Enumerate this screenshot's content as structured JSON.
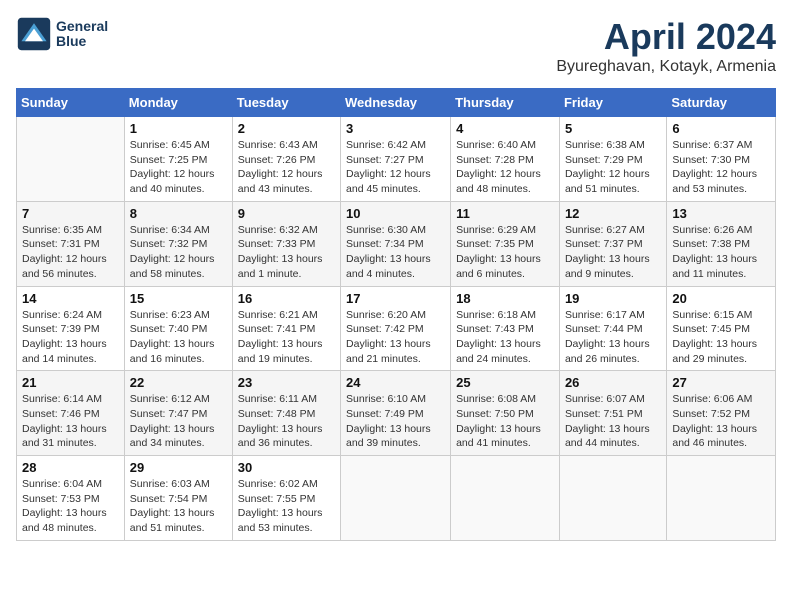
{
  "header": {
    "logo_line1": "General",
    "logo_line2": "Blue",
    "month_title": "April 2024",
    "location": "Byureghavan, Kotayk, Armenia"
  },
  "days_of_week": [
    "Sunday",
    "Monday",
    "Tuesday",
    "Wednesday",
    "Thursday",
    "Friday",
    "Saturday"
  ],
  "weeks": [
    [
      {
        "day": "",
        "sunrise": "",
        "sunset": "",
        "daylight": ""
      },
      {
        "day": "1",
        "sunrise": "Sunrise: 6:45 AM",
        "sunset": "Sunset: 7:25 PM",
        "daylight": "Daylight: 12 hours and 40 minutes."
      },
      {
        "day": "2",
        "sunrise": "Sunrise: 6:43 AM",
        "sunset": "Sunset: 7:26 PM",
        "daylight": "Daylight: 12 hours and 43 minutes."
      },
      {
        "day": "3",
        "sunrise": "Sunrise: 6:42 AM",
        "sunset": "Sunset: 7:27 PM",
        "daylight": "Daylight: 12 hours and 45 minutes."
      },
      {
        "day": "4",
        "sunrise": "Sunrise: 6:40 AM",
        "sunset": "Sunset: 7:28 PM",
        "daylight": "Daylight: 12 hours and 48 minutes."
      },
      {
        "day": "5",
        "sunrise": "Sunrise: 6:38 AM",
        "sunset": "Sunset: 7:29 PM",
        "daylight": "Daylight: 12 hours and 51 minutes."
      },
      {
        "day": "6",
        "sunrise": "Sunrise: 6:37 AM",
        "sunset": "Sunset: 7:30 PM",
        "daylight": "Daylight: 12 hours and 53 minutes."
      }
    ],
    [
      {
        "day": "7",
        "sunrise": "Sunrise: 6:35 AM",
        "sunset": "Sunset: 7:31 PM",
        "daylight": "Daylight: 12 hours and 56 minutes."
      },
      {
        "day": "8",
        "sunrise": "Sunrise: 6:34 AM",
        "sunset": "Sunset: 7:32 PM",
        "daylight": "Daylight: 12 hours and 58 minutes."
      },
      {
        "day": "9",
        "sunrise": "Sunrise: 6:32 AM",
        "sunset": "Sunset: 7:33 PM",
        "daylight": "Daylight: 13 hours and 1 minute."
      },
      {
        "day": "10",
        "sunrise": "Sunrise: 6:30 AM",
        "sunset": "Sunset: 7:34 PM",
        "daylight": "Daylight: 13 hours and 4 minutes."
      },
      {
        "day": "11",
        "sunrise": "Sunrise: 6:29 AM",
        "sunset": "Sunset: 7:35 PM",
        "daylight": "Daylight: 13 hours and 6 minutes."
      },
      {
        "day": "12",
        "sunrise": "Sunrise: 6:27 AM",
        "sunset": "Sunset: 7:37 PM",
        "daylight": "Daylight: 13 hours and 9 minutes."
      },
      {
        "day": "13",
        "sunrise": "Sunrise: 6:26 AM",
        "sunset": "Sunset: 7:38 PM",
        "daylight": "Daylight: 13 hours and 11 minutes."
      }
    ],
    [
      {
        "day": "14",
        "sunrise": "Sunrise: 6:24 AM",
        "sunset": "Sunset: 7:39 PM",
        "daylight": "Daylight: 13 hours and 14 minutes."
      },
      {
        "day": "15",
        "sunrise": "Sunrise: 6:23 AM",
        "sunset": "Sunset: 7:40 PM",
        "daylight": "Daylight: 13 hours and 16 minutes."
      },
      {
        "day": "16",
        "sunrise": "Sunrise: 6:21 AM",
        "sunset": "Sunset: 7:41 PM",
        "daylight": "Daylight: 13 hours and 19 minutes."
      },
      {
        "day": "17",
        "sunrise": "Sunrise: 6:20 AM",
        "sunset": "Sunset: 7:42 PM",
        "daylight": "Daylight: 13 hours and 21 minutes."
      },
      {
        "day": "18",
        "sunrise": "Sunrise: 6:18 AM",
        "sunset": "Sunset: 7:43 PM",
        "daylight": "Daylight: 13 hours and 24 minutes."
      },
      {
        "day": "19",
        "sunrise": "Sunrise: 6:17 AM",
        "sunset": "Sunset: 7:44 PM",
        "daylight": "Daylight: 13 hours and 26 minutes."
      },
      {
        "day": "20",
        "sunrise": "Sunrise: 6:15 AM",
        "sunset": "Sunset: 7:45 PM",
        "daylight": "Daylight: 13 hours and 29 minutes."
      }
    ],
    [
      {
        "day": "21",
        "sunrise": "Sunrise: 6:14 AM",
        "sunset": "Sunset: 7:46 PM",
        "daylight": "Daylight: 13 hours and 31 minutes."
      },
      {
        "day": "22",
        "sunrise": "Sunrise: 6:12 AM",
        "sunset": "Sunset: 7:47 PM",
        "daylight": "Daylight: 13 hours and 34 minutes."
      },
      {
        "day": "23",
        "sunrise": "Sunrise: 6:11 AM",
        "sunset": "Sunset: 7:48 PM",
        "daylight": "Daylight: 13 hours and 36 minutes."
      },
      {
        "day": "24",
        "sunrise": "Sunrise: 6:10 AM",
        "sunset": "Sunset: 7:49 PM",
        "daylight": "Daylight: 13 hours and 39 minutes."
      },
      {
        "day": "25",
        "sunrise": "Sunrise: 6:08 AM",
        "sunset": "Sunset: 7:50 PM",
        "daylight": "Daylight: 13 hours and 41 minutes."
      },
      {
        "day": "26",
        "sunrise": "Sunrise: 6:07 AM",
        "sunset": "Sunset: 7:51 PM",
        "daylight": "Daylight: 13 hours and 44 minutes."
      },
      {
        "day": "27",
        "sunrise": "Sunrise: 6:06 AM",
        "sunset": "Sunset: 7:52 PM",
        "daylight": "Daylight: 13 hours and 46 minutes."
      }
    ],
    [
      {
        "day": "28",
        "sunrise": "Sunrise: 6:04 AM",
        "sunset": "Sunset: 7:53 PM",
        "daylight": "Daylight: 13 hours and 48 minutes."
      },
      {
        "day": "29",
        "sunrise": "Sunrise: 6:03 AM",
        "sunset": "Sunset: 7:54 PM",
        "daylight": "Daylight: 13 hours and 51 minutes."
      },
      {
        "day": "30",
        "sunrise": "Sunrise: 6:02 AM",
        "sunset": "Sunset: 7:55 PM",
        "daylight": "Daylight: 13 hours and 53 minutes."
      },
      {
        "day": "",
        "sunrise": "",
        "sunset": "",
        "daylight": ""
      },
      {
        "day": "",
        "sunrise": "",
        "sunset": "",
        "daylight": ""
      },
      {
        "day": "",
        "sunrise": "",
        "sunset": "",
        "daylight": ""
      },
      {
        "day": "",
        "sunrise": "",
        "sunset": "",
        "daylight": ""
      }
    ]
  ]
}
